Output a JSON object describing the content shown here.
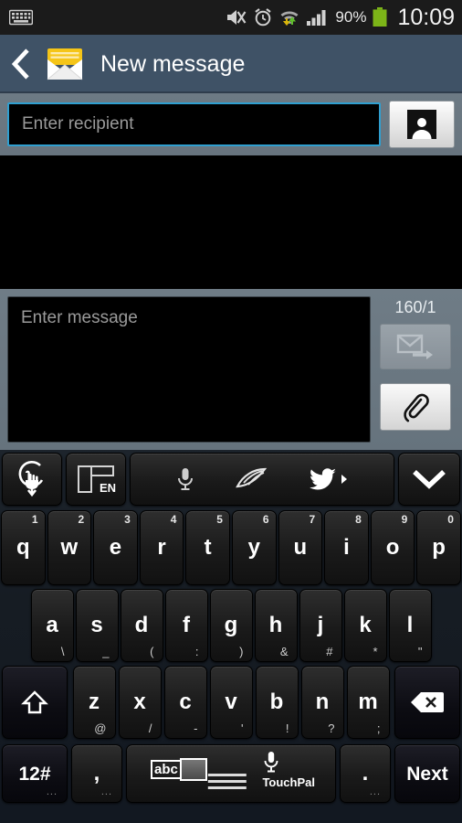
{
  "statusbar": {
    "keyboard_icon": "keyboard-icon",
    "mute_icon": "mute-icon",
    "alarm_icon": "alarm-icon",
    "wifi_icon": "wifi-data-icon",
    "signal_icon": "signal-icon",
    "battery_percent": "90%",
    "battery_icon": "battery-icon",
    "clock": "10:09",
    "battery_color": "#7cb518"
  },
  "titlebar": {
    "back_icon": "back-chevron-icon",
    "app_icon": "message-envelope-icon",
    "title": "New message",
    "bg_color": "#3f5266"
  },
  "recipient": {
    "placeholder": "Enter recipient",
    "value": "",
    "focus_color": "#2f9fd0",
    "contacts_icon": "contacts-person-icon"
  },
  "compose": {
    "placeholder": "Enter message",
    "value": "",
    "counter": "160/1",
    "send_icon": "send-message-icon",
    "send_enabled": false,
    "attach_icon": "attachment-paperclip-icon"
  },
  "keyboard": {
    "toolbar": {
      "gesture_icon": "swipe-gesture-icon",
      "language_icon": "keyboard-layout-icon",
      "language_label": "EN",
      "voice_icon": "microphone-icon",
      "handwriting_icon": "handwriting-pen-icon",
      "twitter_icon": "twitter-bird-icon",
      "more_icon": "more-arrow-icon",
      "collapse_icon": "collapse-chevron-down-icon"
    },
    "row1": [
      {
        "main": "q",
        "sup": "1"
      },
      {
        "main": "w",
        "sup": "2"
      },
      {
        "main": "e",
        "sup": "3"
      },
      {
        "main": "r",
        "sup": "4"
      },
      {
        "main": "t",
        "sup": "5"
      },
      {
        "main": "y",
        "sup": "6"
      },
      {
        "main": "u",
        "sup": "7"
      },
      {
        "main": "i",
        "sup": "8"
      },
      {
        "main": "o",
        "sup": "9"
      },
      {
        "main": "p",
        "sup": "0"
      }
    ],
    "row2": [
      {
        "main": "a",
        "sub": "\\"
      },
      {
        "main": "s",
        "sub": "_"
      },
      {
        "main": "d",
        "sub": "("
      },
      {
        "main": "f",
        "sub": ":"
      },
      {
        "main": "g",
        "sub": ")"
      },
      {
        "main": "h",
        "sub": "&"
      },
      {
        "main": "j",
        "sub": "#"
      },
      {
        "main": "k",
        "sub": "*"
      },
      {
        "main": "l",
        "sub": "\""
      }
    ],
    "row3": [
      {
        "main": "z",
        "sub": "@"
      },
      {
        "main": "x",
        "sub": "/"
      },
      {
        "main": "c",
        "sub": "-"
      },
      {
        "main": "v",
        "sub": "'"
      },
      {
        "main": "b",
        "sub": "!"
      },
      {
        "main": "n",
        "sub": "?"
      },
      {
        "main": "m",
        "sub": ";"
      }
    ],
    "shift_icon": "shift-arrow-icon",
    "backspace_icon": "backspace-icon",
    "row4": {
      "numeric_label": "12#",
      "numeric_dots": "...",
      "comma_label": ",",
      "comma_dots": "...",
      "space_abc": "abc",
      "space_brand": "TouchPal",
      "space_mic_icon": "microphone-icon",
      "period_label": ".",
      "period_dots": "...",
      "next_label": "Next"
    }
  }
}
